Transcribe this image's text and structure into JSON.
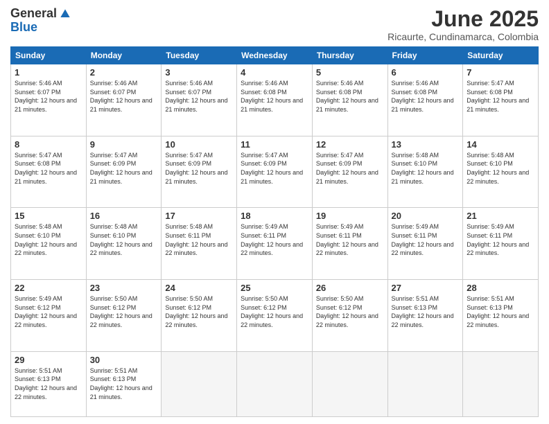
{
  "header": {
    "logo_general": "General",
    "logo_blue": "Blue",
    "month_title": "June 2025",
    "location": "Ricaurte, Cundinamarca, Colombia"
  },
  "days_of_week": [
    "Sunday",
    "Monday",
    "Tuesday",
    "Wednesday",
    "Thursday",
    "Friday",
    "Saturday"
  ],
  "weeks": [
    [
      {
        "day": 1,
        "sunrise": "Sunrise: 5:46 AM",
        "sunset": "Sunset: 6:07 PM",
        "daylight": "Daylight: 12 hours and 21 minutes."
      },
      {
        "day": 2,
        "sunrise": "Sunrise: 5:46 AM",
        "sunset": "Sunset: 6:07 PM",
        "daylight": "Daylight: 12 hours and 21 minutes."
      },
      {
        "day": 3,
        "sunrise": "Sunrise: 5:46 AM",
        "sunset": "Sunset: 6:07 PM",
        "daylight": "Daylight: 12 hours and 21 minutes."
      },
      {
        "day": 4,
        "sunrise": "Sunrise: 5:46 AM",
        "sunset": "Sunset: 6:08 PM",
        "daylight": "Daylight: 12 hours and 21 minutes."
      },
      {
        "day": 5,
        "sunrise": "Sunrise: 5:46 AM",
        "sunset": "Sunset: 6:08 PM",
        "daylight": "Daylight: 12 hours and 21 minutes."
      },
      {
        "day": 6,
        "sunrise": "Sunrise: 5:46 AM",
        "sunset": "Sunset: 6:08 PM",
        "daylight": "Daylight: 12 hours and 21 minutes."
      },
      {
        "day": 7,
        "sunrise": "Sunrise: 5:47 AM",
        "sunset": "Sunset: 6:08 PM",
        "daylight": "Daylight: 12 hours and 21 minutes."
      }
    ],
    [
      {
        "day": 8,
        "sunrise": "Sunrise: 5:47 AM",
        "sunset": "Sunset: 6:08 PM",
        "daylight": "Daylight: 12 hours and 21 minutes."
      },
      {
        "day": 9,
        "sunrise": "Sunrise: 5:47 AM",
        "sunset": "Sunset: 6:09 PM",
        "daylight": "Daylight: 12 hours and 21 minutes."
      },
      {
        "day": 10,
        "sunrise": "Sunrise: 5:47 AM",
        "sunset": "Sunset: 6:09 PM",
        "daylight": "Daylight: 12 hours and 21 minutes."
      },
      {
        "day": 11,
        "sunrise": "Sunrise: 5:47 AM",
        "sunset": "Sunset: 6:09 PM",
        "daylight": "Daylight: 12 hours and 21 minutes."
      },
      {
        "day": 12,
        "sunrise": "Sunrise: 5:47 AM",
        "sunset": "Sunset: 6:09 PM",
        "daylight": "Daylight: 12 hours and 21 minutes."
      },
      {
        "day": 13,
        "sunrise": "Sunrise: 5:48 AM",
        "sunset": "Sunset: 6:10 PM",
        "daylight": "Daylight: 12 hours and 21 minutes."
      },
      {
        "day": 14,
        "sunrise": "Sunrise: 5:48 AM",
        "sunset": "Sunset: 6:10 PM",
        "daylight": "Daylight: 12 hours and 22 minutes."
      }
    ],
    [
      {
        "day": 15,
        "sunrise": "Sunrise: 5:48 AM",
        "sunset": "Sunset: 6:10 PM",
        "daylight": "Daylight: 12 hours and 22 minutes."
      },
      {
        "day": 16,
        "sunrise": "Sunrise: 5:48 AM",
        "sunset": "Sunset: 6:10 PM",
        "daylight": "Daylight: 12 hours and 22 minutes."
      },
      {
        "day": 17,
        "sunrise": "Sunrise: 5:48 AM",
        "sunset": "Sunset: 6:11 PM",
        "daylight": "Daylight: 12 hours and 22 minutes."
      },
      {
        "day": 18,
        "sunrise": "Sunrise: 5:49 AM",
        "sunset": "Sunset: 6:11 PM",
        "daylight": "Daylight: 12 hours and 22 minutes."
      },
      {
        "day": 19,
        "sunrise": "Sunrise: 5:49 AM",
        "sunset": "Sunset: 6:11 PM",
        "daylight": "Daylight: 12 hours and 22 minutes."
      },
      {
        "day": 20,
        "sunrise": "Sunrise: 5:49 AM",
        "sunset": "Sunset: 6:11 PM",
        "daylight": "Daylight: 12 hours and 22 minutes."
      },
      {
        "day": 21,
        "sunrise": "Sunrise: 5:49 AM",
        "sunset": "Sunset: 6:11 PM",
        "daylight": "Daylight: 12 hours and 22 minutes."
      }
    ],
    [
      {
        "day": 22,
        "sunrise": "Sunrise: 5:49 AM",
        "sunset": "Sunset: 6:12 PM",
        "daylight": "Daylight: 12 hours and 22 minutes."
      },
      {
        "day": 23,
        "sunrise": "Sunrise: 5:50 AM",
        "sunset": "Sunset: 6:12 PM",
        "daylight": "Daylight: 12 hours and 22 minutes."
      },
      {
        "day": 24,
        "sunrise": "Sunrise: 5:50 AM",
        "sunset": "Sunset: 6:12 PM",
        "daylight": "Daylight: 12 hours and 22 minutes."
      },
      {
        "day": 25,
        "sunrise": "Sunrise: 5:50 AM",
        "sunset": "Sunset: 6:12 PM",
        "daylight": "Daylight: 12 hours and 22 minutes."
      },
      {
        "day": 26,
        "sunrise": "Sunrise: 5:50 AM",
        "sunset": "Sunset: 6:12 PM",
        "daylight": "Daylight: 12 hours and 22 minutes."
      },
      {
        "day": 27,
        "sunrise": "Sunrise: 5:51 AM",
        "sunset": "Sunset: 6:13 PM",
        "daylight": "Daylight: 12 hours and 22 minutes."
      },
      {
        "day": 28,
        "sunrise": "Sunrise: 5:51 AM",
        "sunset": "Sunset: 6:13 PM",
        "daylight": "Daylight: 12 hours and 22 minutes."
      }
    ],
    [
      {
        "day": 29,
        "sunrise": "Sunrise: 5:51 AM",
        "sunset": "Sunset: 6:13 PM",
        "daylight": "Daylight: 12 hours and 22 minutes."
      },
      {
        "day": 30,
        "sunrise": "Sunrise: 5:51 AM",
        "sunset": "Sunset: 6:13 PM",
        "daylight": "Daylight: 12 hours and 21 minutes."
      },
      null,
      null,
      null,
      null,
      null
    ]
  ]
}
